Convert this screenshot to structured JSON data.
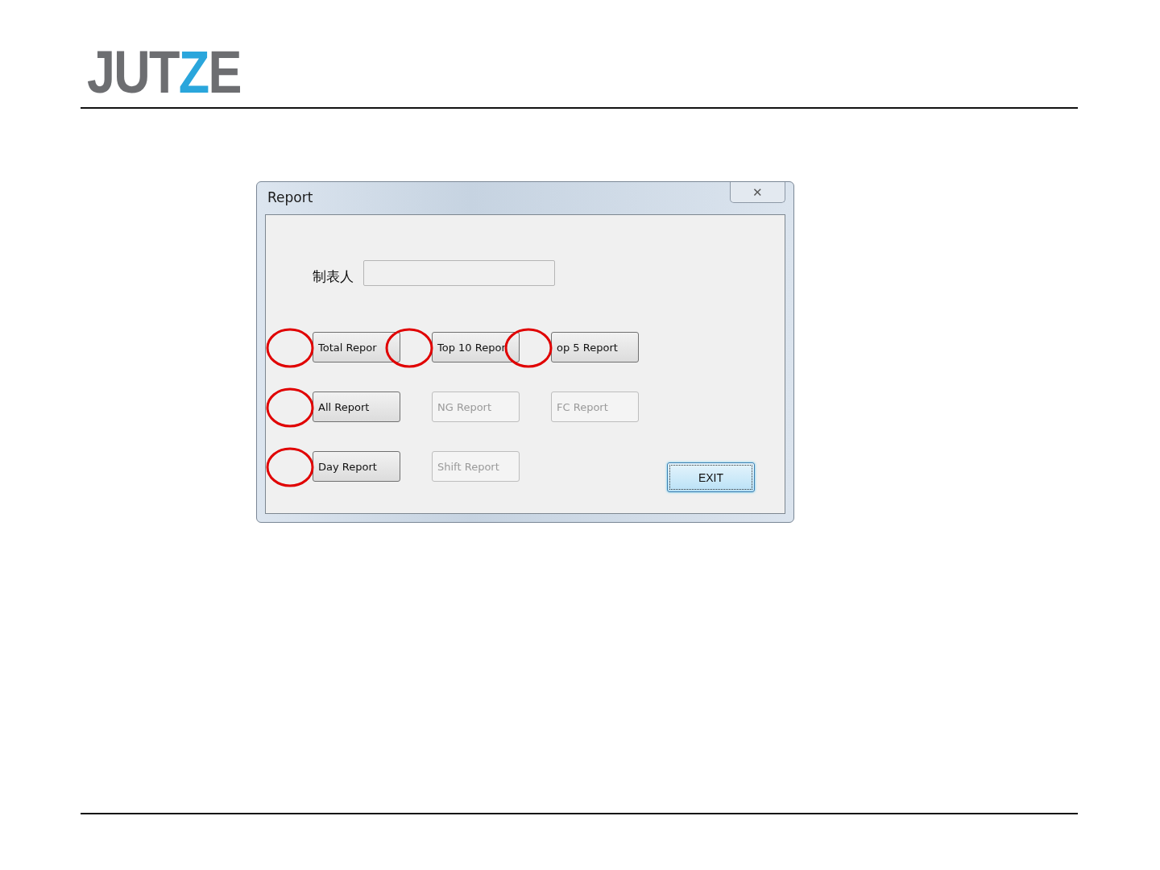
{
  "logo": [
    {
      "text": "JUT",
      "color": "#6d6e71"
    },
    {
      "text": "Z",
      "color": "#2aa6dc"
    },
    {
      "text": "E",
      "color": "#6d6e71"
    }
  ],
  "window": {
    "title": "Report",
    "close": "✕"
  },
  "field": {
    "label": "制表人"
  },
  "buttons": [
    {
      "label": "Total Repor",
      "disabled": false,
      "marked": true
    },
    {
      "label": "Top 10 Repor",
      "disabled": false,
      "marked": true
    },
    {
      "label": "op 5 Report",
      "disabled": false,
      "marked": true
    },
    {
      "label": "All Report",
      "disabled": false,
      "marked": true
    },
    {
      "label": "NG Report",
      "disabled": true,
      "marked": false
    },
    {
      "label": "FC Report",
      "disabled": true,
      "marked": false
    },
    {
      "label": "Day Report",
      "disabled": false,
      "marked": true
    },
    {
      "label": "Shift Report",
      "disabled": true,
      "marked": false
    }
  ],
  "exit": {
    "label": "EXIT",
    "focused": true
  }
}
